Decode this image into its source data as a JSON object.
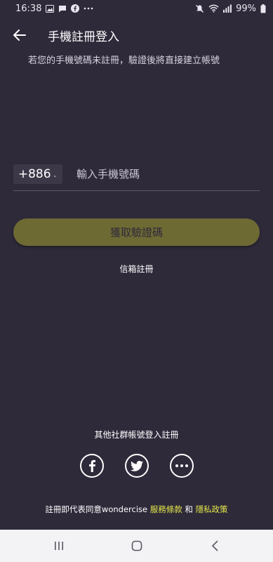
{
  "status_bar": {
    "time": "16:38",
    "left_icons": [
      "gallery-icon",
      "message-icon",
      "facebook-icon",
      "more-dots-icon"
    ],
    "right_icons": [
      "mute-icon",
      "wifi-icon",
      "signal-icon"
    ],
    "battery": "99%"
  },
  "header": {
    "title": "手機註冊登入",
    "back_icon": "arrow-left-icon"
  },
  "subtitle": "若您的手機號碼未註冊，驗證後將直接建立帳號",
  "phone": {
    "country_code": "+886",
    "placeholder": "輸入手機號碼",
    "value": ""
  },
  "get_code_label": "獲取驗證碼",
  "email_register_label": "信箱註冊",
  "social": {
    "heading": "其他社群帳號登入註冊",
    "buttons": [
      "facebook-icon",
      "twitter-icon",
      "more-icon"
    ]
  },
  "terms": {
    "prefix": "註冊即代表同意wondercise",
    "service_link": "服務條款",
    "conjunction": "和",
    "privacy_link": "隱私政策"
  },
  "colors": {
    "background": "#2f2a3a",
    "button": "#6e6a34",
    "link": "#e2e64a",
    "nav_bar": "#f3f2f5"
  }
}
